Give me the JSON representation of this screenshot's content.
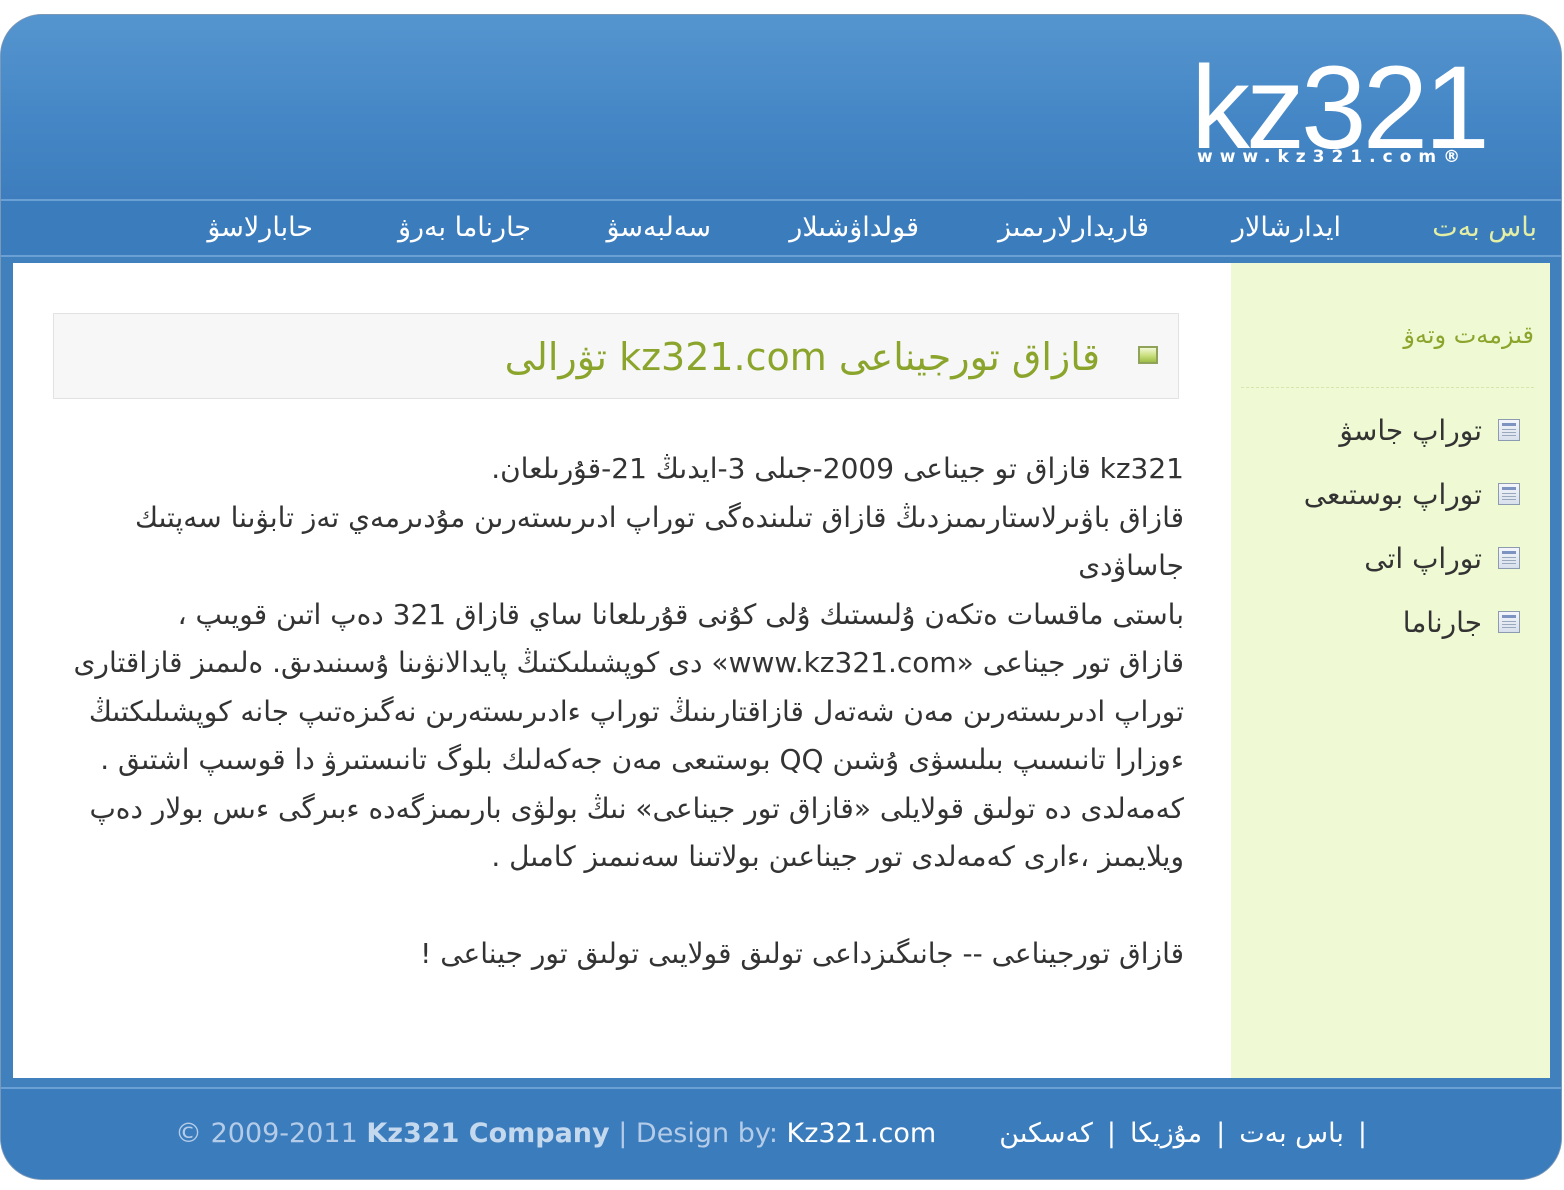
{
  "logo": {
    "text": "kz321",
    "subtext": "www.kz321.com®"
  },
  "nav": {
    "items": [
      {
        "label": "باس بەت"
      },
      {
        "label": "ايدارشالار"
      },
      {
        "label": "قاريدارلارىمىز"
      },
      {
        "label": "قولداۋشىلار"
      },
      {
        "label": "سەلبەسۋ"
      },
      {
        "label": "جارناما بەرۋ"
      },
      {
        "label": "حابارلاسۋ"
      }
    ]
  },
  "content": {
    "title": "قازاق تورجيناعى kz321.com تۋرالى",
    "paragraphs": [
      "kz321 قازاق تو جيناعى 2009-جىلى 3-ايدىڭ 21-قۇرىلعان.",
      "قازاق باۋىرلاستارىمىزدىڭ قازاق تىلىندەگى توراپ ادىرىستەرىن مۇدىرمەي تەز تابۋىنا سەپتىك جاساۋدى",
      "باستى ماقسات ەتكەن ۇلىستىك ۇلى كۇنى قۇرىلعانا ساي قازاق 321 دەپ اتىن قويىپ ،",
      "قازاق تور جيناعى «www.kz321.com» دى كوپشىلىكتىڭ پايدالانۋىنا ۇسىنىدىق. ەلىمىز قازاقتارى توراپ ادىرىستەرىن مەن شەتەل قازاقتارىنىڭ توراپ ءادىرىستەرىن نەگىزەتىپ جانە كوپشىلىكتىڭ ءوزارا تانىسىپ بىلىسۋى ۇشىن QQ بوستىعى مەن جەكەلىك بلوگ تانىستىرۋ دا قوسىپ اشتىق . كەمەلدى دە تولىق قولايلى «قازاق تور جيناعى» نىڭ بولۋى بارىمىزگەدە ءبىرگى ءىس بولار دەپ ويلايمىز ،ءارى كەمەلدى تور جيناعىن بولاتىنا سەنىمىز كامىل ."
    ],
    "closing": "قازاق تورجيناعى -- جانىگىزداعى تولىق قولايىى تولىق تور جيناعى !"
  },
  "sidebar": {
    "title": "قىزمەت وتەۋ",
    "items": [
      {
        "label": "توراپ جاسۋ"
      },
      {
        "label": "توراپ بوستىعى"
      },
      {
        "label": "توراپ اتى"
      },
      {
        "label": "جارناما"
      }
    ]
  },
  "footer": {
    "copyright": "© 2009-2011",
    "company": "Kz321 Company",
    "design_by": "| Design by:",
    "designer": "Kz321.com",
    "links": [
      {
        "label": "باس بەت"
      },
      {
        "label": "مۇزيكا"
      },
      {
        "label": "كەسكىن"
      }
    ],
    "separator": "|"
  },
  "colors": {
    "header_blue": "#4587c6",
    "nav_active": "#e4efa6",
    "title_green": "#8ba52c",
    "sidebar_bg": "#eff9d3"
  }
}
